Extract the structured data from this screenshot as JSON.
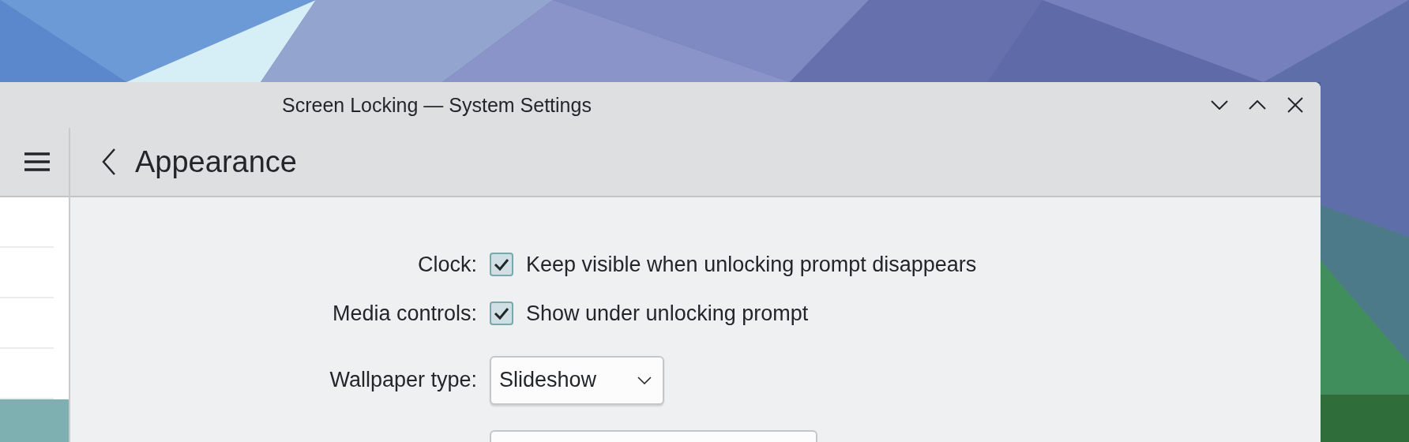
{
  "window": {
    "title": "Screen Locking — System Settings"
  },
  "sidebar": {
    "items": [
      {
        "selected": false
      },
      {
        "selected": false
      },
      {
        "selected": false
      },
      {
        "selected": false
      },
      {
        "selected": true
      }
    ]
  },
  "page": {
    "title": "Appearance"
  },
  "form": {
    "rows": [
      {
        "kind": "checkbox",
        "label": "Clock:",
        "text": "Keep visible when unlocking prompt disappears",
        "checked": true
      },
      {
        "kind": "checkbox",
        "label": "Media controls:",
        "text": "Show under unlocking prompt",
        "checked": true
      },
      {
        "kind": "combo",
        "label": "Wallpaper type:",
        "value": "Slideshow"
      },
      {
        "kind": "field"
      }
    ]
  }
}
